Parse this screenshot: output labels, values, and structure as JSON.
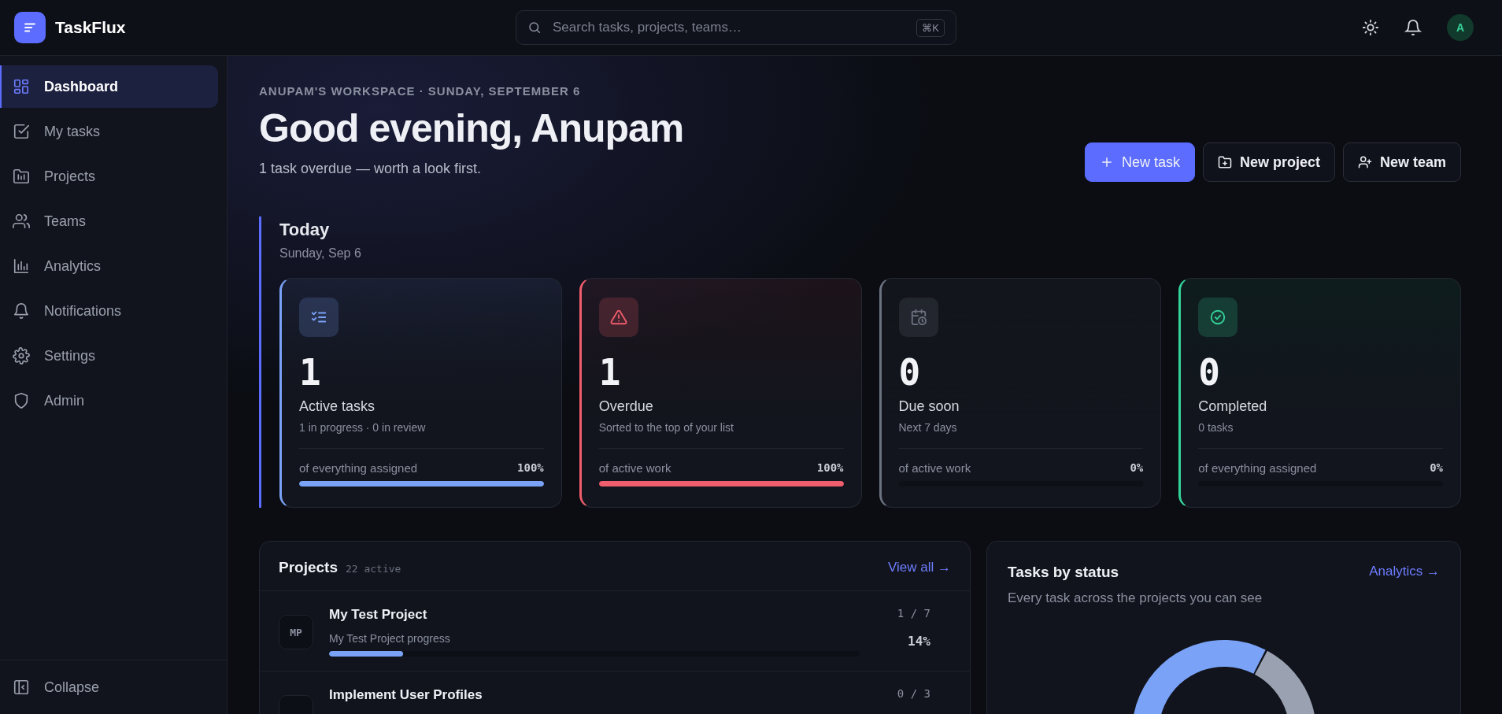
{
  "app": {
    "name": "TaskFlux"
  },
  "search": {
    "placeholder": "Search tasks, projects, teams…",
    "shortcut": "⌘K"
  },
  "user": {
    "initial": "A"
  },
  "sidebar": {
    "items": [
      {
        "label": "Dashboard",
        "selected": true
      },
      {
        "label": "My tasks",
        "selected": false
      },
      {
        "label": "Projects",
        "selected": false
      },
      {
        "label": "Teams",
        "selected": false
      },
      {
        "label": "Analytics",
        "selected": false
      },
      {
        "label": "Notifications",
        "selected": false
      },
      {
        "label": "Settings",
        "selected": false
      },
      {
        "label": "Admin",
        "selected": false
      }
    ],
    "collapse": "Collapse"
  },
  "header": {
    "eyebrow": "ANUPAM'S WORKSPACE · SUNDAY, SEPTEMBER 6",
    "title": "Good evening, Anupam",
    "subtitle": "1 task overdue — worth a look first.",
    "buttons": [
      {
        "label": "New task",
        "kind": "primary"
      },
      {
        "label": "New project",
        "kind": "project"
      },
      {
        "label": "New team",
        "kind": "team"
      }
    ]
  },
  "today": {
    "title": "Today",
    "date": "Sunday, Sep 6",
    "cards": [
      {
        "kind": "list",
        "color": "#7aa2f7",
        "value": "1",
        "label": "Active tasks",
        "detail": "1 in progress · 0 in review",
        "footer": "of everything assigned",
        "percent": "100%",
        "level": 1
      },
      {
        "kind": "warning",
        "color": "#f05d6c",
        "value": "1",
        "label": "Overdue",
        "detail": "Sorted to the top of your list",
        "footer": "of active work",
        "percent": "100%",
        "level": 1
      },
      {
        "kind": "calendar",
        "color": "#6b7280",
        "value": "0",
        "label": "Due soon",
        "detail": "Next 7 days",
        "footer": "of active work",
        "percent": "0%",
        "level": 0
      },
      {
        "kind": "done",
        "color": "#34d399",
        "value": "0",
        "label": "Completed",
        "detail": "0 tasks",
        "footer": "of everything assigned",
        "percent": "0%",
        "level": 0
      }
    ]
  },
  "projects": {
    "title": "Projects",
    "count": "22 active",
    "link": "View all →",
    "rows": [
      {
        "initials": "MP",
        "name": "My Test Project",
        "subtitle": "My Test Project progress",
        "count": "1 / 7",
        "percent": "14%",
        "level": 0.14
      },
      {
        "name": "Implement User Profiles",
        "count": "0 / 3"
      }
    ]
  },
  "tasks_by_status": {
    "title": "Tasks by status",
    "link": "Analytics →",
    "subtitle": "Every task across the projects you can see"
  }
}
